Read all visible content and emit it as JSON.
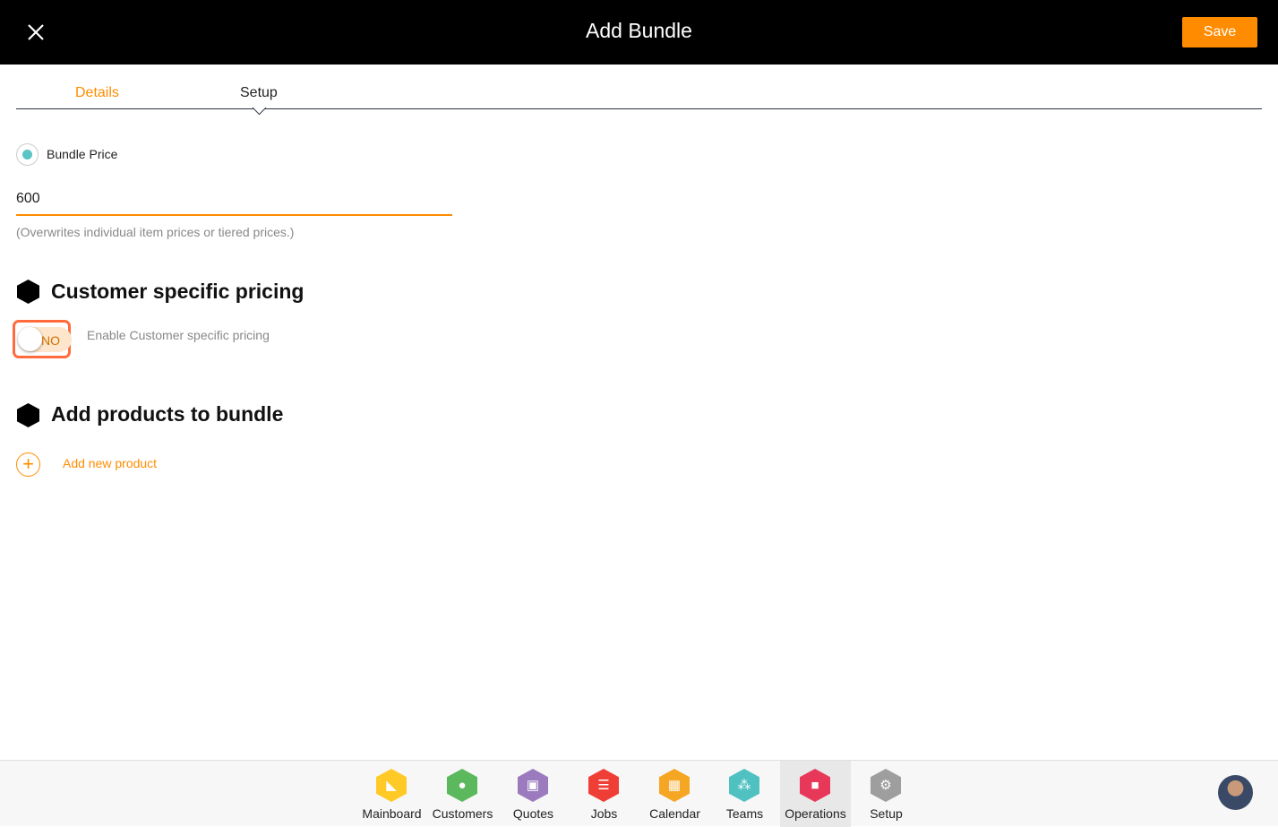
{
  "header": {
    "title": "Add Bundle",
    "save_label": "Save"
  },
  "tabs": [
    {
      "label": "Details"
    },
    {
      "label": "Setup",
      "active": true
    }
  ],
  "pricing": {
    "radio_label": "Bundle Price",
    "selected": true,
    "price_value": "600",
    "hint": "(Overwrites individual item prices or tiered prices.)"
  },
  "customer_pricing": {
    "title": "Customer specific pricing",
    "toggle_text": "NO",
    "toggle_label": "Enable Customer specific pricing",
    "enabled": false
  },
  "products": {
    "title": "Add products to bundle",
    "add_label": "Add new product"
  },
  "nav": [
    {
      "label": "Mainboard",
      "color": "#ffc926",
      "icon": "mainboard-icon"
    },
    {
      "label": "Customers",
      "color": "#5cb85c",
      "icon": "customer-icon"
    },
    {
      "label": "Quotes",
      "color": "#9b7bbd",
      "icon": "quotes-icon"
    },
    {
      "label": "Jobs",
      "color": "#ef3e36",
      "icon": "list-icon"
    },
    {
      "label": "Calendar",
      "color": "#f5a623",
      "icon": "calendar-icon"
    },
    {
      "label": "Teams",
      "color": "#4fc1c1",
      "icon": "teams-icon"
    },
    {
      "label": "Operations",
      "color": "#e8385a",
      "icon": "briefcase-icon",
      "active": true
    },
    {
      "label": "Setup",
      "color": "#9e9e9e",
      "icon": "gear-icon"
    }
  ],
  "accent": "#ff8c00"
}
